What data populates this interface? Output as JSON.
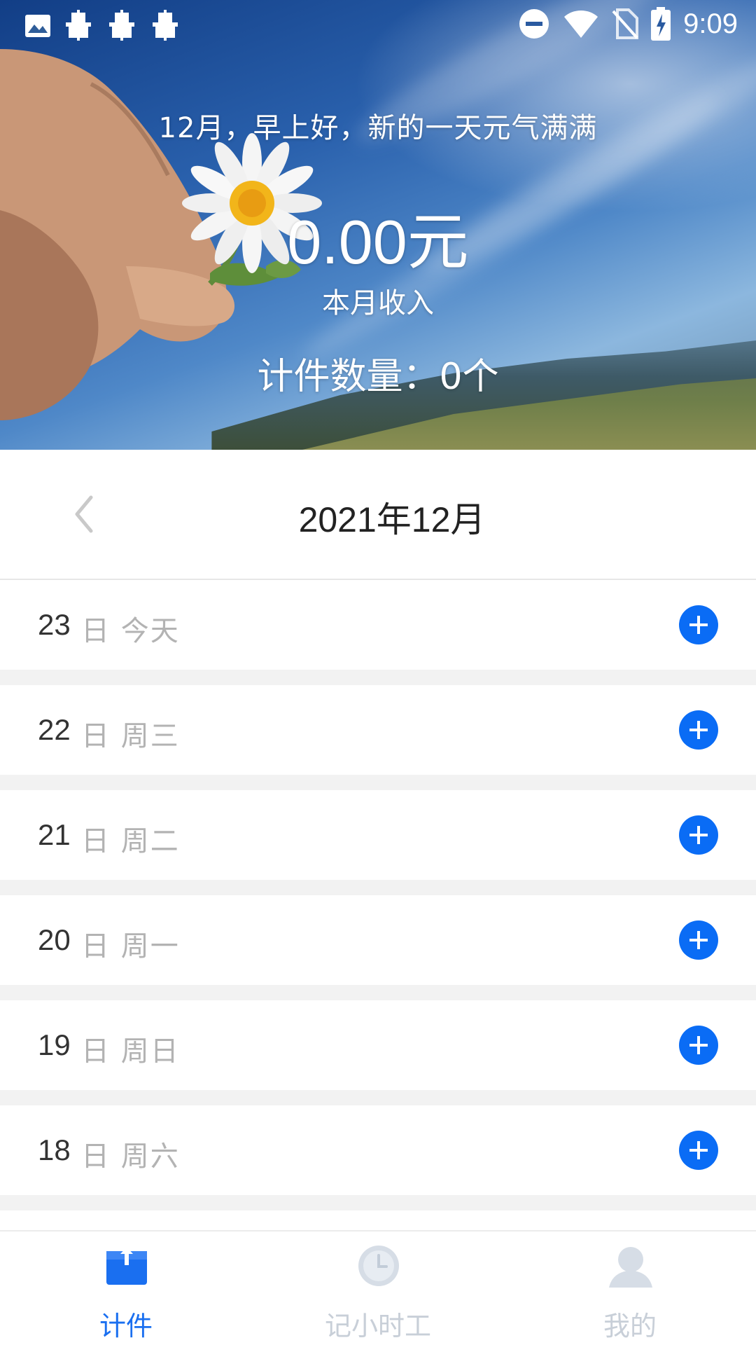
{
  "status_bar": {
    "time": "9:09",
    "left_icons": [
      "image-icon",
      "bug-icon",
      "bug-icon",
      "bug-icon"
    ],
    "right_icons": [
      "do-not-disturb-icon",
      "wifi-icon",
      "no-sim-icon",
      "battery-charging-icon"
    ]
  },
  "hero": {
    "greeting": "12月，早上好，新的一天元气满满",
    "income_amount": "0.00元",
    "income_label": "本月收入",
    "piece_count": "计件数量：0个"
  },
  "month_selector": {
    "title": "2021年12月",
    "prev_icon": "chevron-left-icon"
  },
  "days": [
    {
      "num": "23",
      "rest": "日 今天"
    },
    {
      "num": "22",
      "rest": "日 周三"
    },
    {
      "num": "21",
      "rest": "日 周二"
    },
    {
      "num": "20",
      "rest": "日 周一"
    },
    {
      "num": "19",
      "rest": "日 周日"
    },
    {
      "num": "18",
      "rest": "日 周六"
    }
  ],
  "bottom_nav": {
    "items": [
      {
        "label": "计件",
        "icon": "gift-box-icon",
        "active": true
      },
      {
        "label": "记小时工",
        "icon": "clock-icon",
        "active": false
      },
      {
        "label": "我的",
        "icon": "user-icon",
        "active": false
      }
    ]
  },
  "colors": {
    "accent": "#0a6cf5",
    "nav_active": "#1a6ff0",
    "nav_inactive": "#c8cfd8",
    "weekday_text": "#b3b3b3",
    "page_background": "#f2f2f2"
  }
}
